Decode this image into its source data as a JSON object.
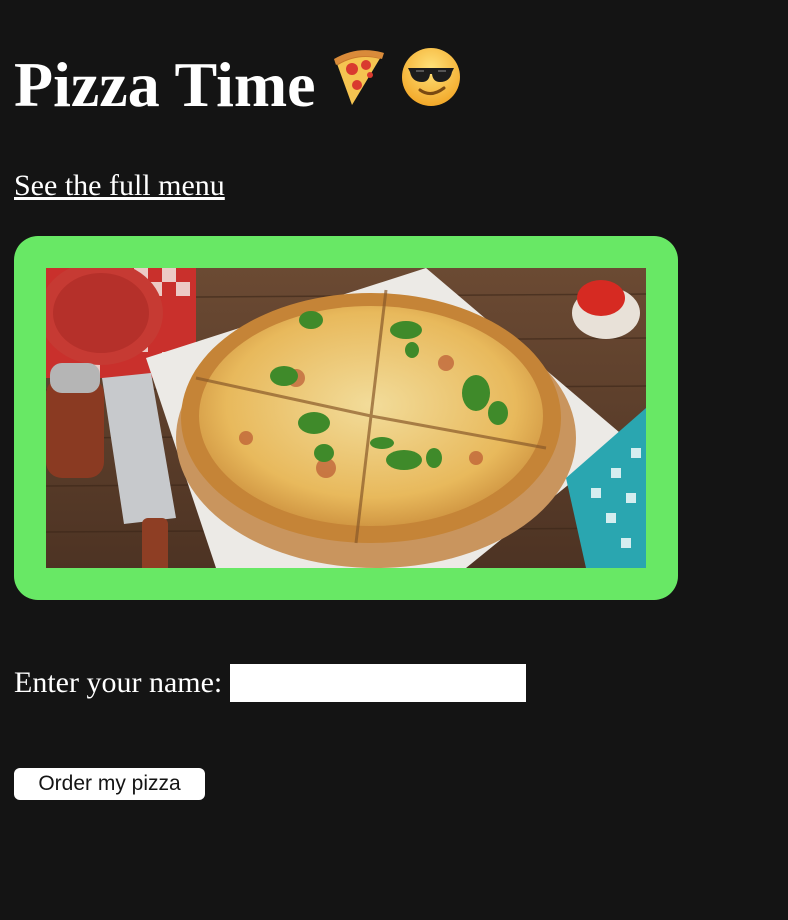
{
  "header": {
    "title": "Pizza Time",
    "emoji_pizza": "pizza-slice-emoji",
    "emoji_face": "sunglasses-face-emoji"
  },
  "links": {
    "menu_label": "See the full menu"
  },
  "hero": {
    "frame_color": "#68e865",
    "image_subject": "pizza-photo"
  },
  "form": {
    "name_label": "Enter your name:",
    "name_value": "",
    "name_placeholder": "",
    "submit_label": "Order my pizza"
  },
  "colors": {
    "background": "#141414",
    "text": "#ffffff",
    "accent": "#68e865"
  }
}
